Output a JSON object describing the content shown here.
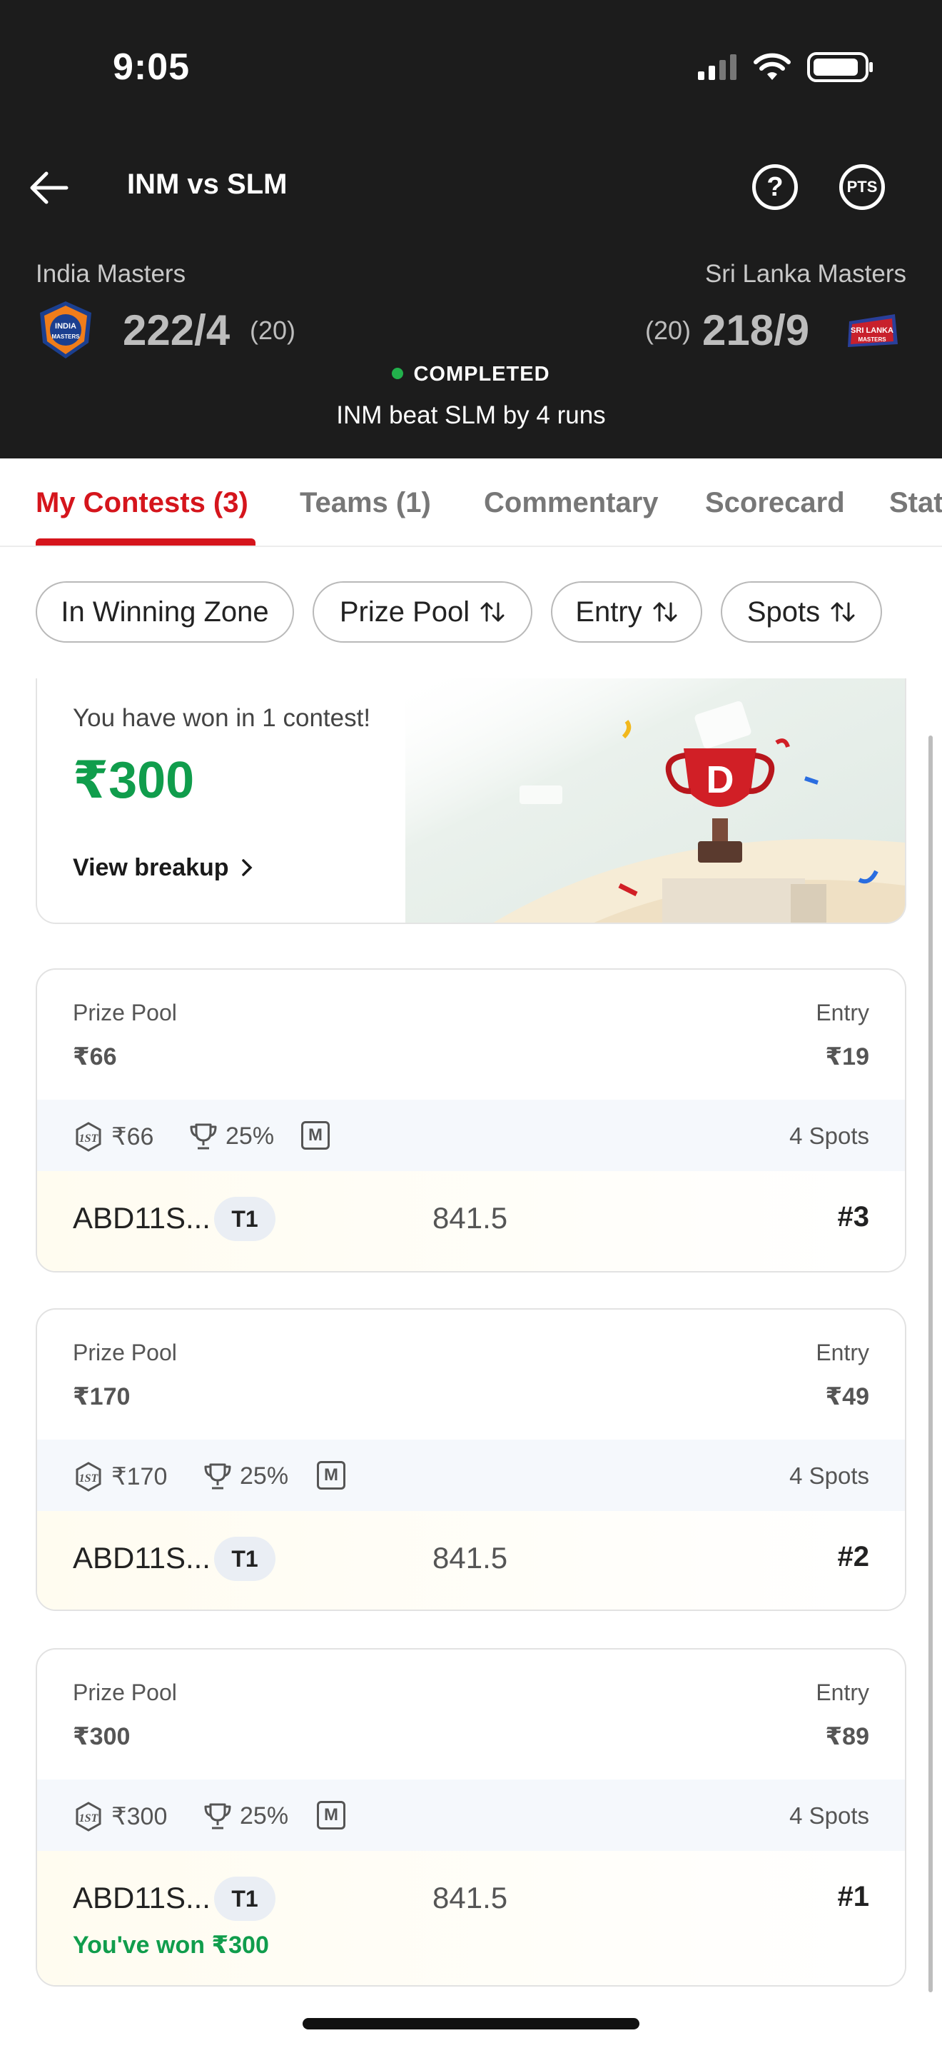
{
  "status_bar": {
    "time": "9:05"
  },
  "nav": {
    "title": "INM vs SLM",
    "help": "?",
    "pts": "PTS"
  },
  "match": {
    "team_left": {
      "name": "India Masters",
      "logo_text": "INDIA MASTERS",
      "score": "222/4",
      "overs": "(20)"
    },
    "team_right": {
      "name": "Sri Lanka Masters",
      "logo_text": "SRI LANKA MASTERS",
      "score": "218/9",
      "overs": "(20)"
    },
    "status": "COMPLETED",
    "result": "INM beat SLM by 4 runs"
  },
  "tabs": [
    {
      "label": "My Contests (3)",
      "active": true
    },
    {
      "label": "Teams (1)"
    },
    {
      "label": "Commentary"
    },
    {
      "label": "Scorecard"
    },
    {
      "label": "Stat"
    }
  ],
  "filters": [
    {
      "label": "In Winning Zone",
      "sort": false
    },
    {
      "label": "Prize Pool",
      "sort": true
    },
    {
      "label": "Entry",
      "sort": true
    },
    {
      "label": "Spots",
      "sort": true
    }
  ],
  "winnings": {
    "text": "You have won in 1 contest!",
    "amount": "₹300",
    "breakup_label": "View breakup",
    "trophy_letter": "D"
  },
  "contests": [
    {
      "prize_pool_label": "Prize Pool",
      "prize_pool": "₹66",
      "entry_label": "Entry",
      "entry": "₹19",
      "first_prize": "₹66",
      "winners": "25%",
      "m_badge": "M",
      "spots": "4 Spots",
      "team": "ABD11S...",
      "team_badge": "T1",
      "points": "841.5",
      "rank": "#3",
      "won": ""
    },
    {
      "prize_pool_label": "Prize Pool",
      "prize_pool": "₹170",
      "entry_label": "Entry",
      "entry": "₹49",
      "first_prize": "₹170",
      "winners": "25%",
      "m_badge": "M",
      "spots": "4 Spots",
      "team": "ABD11S...",
      "team_badge": "T1",
      "points": "841.5",
      "rank": "#2",
      "won": ""
    },
    {
      "prize_pool_label": "Prize Pool",
      "prize_pool": "₹300",
      "entry_label": "Entry",
      "entry": "₹89",
      "first_prize": "₹300",
      "winners": "25%",
      "m_badge": "M",
      "spots": "4 Spots",
      "team": "ABD11S...",
      "team_badge": "T1",
      "points": "841.5",
      "rank": "#1",
      "won": "You've won ₹300"
    }
  ],
  "colors": {
    "accent": "#d5151c",
    "win_green": "#109d4c",
    "header_bg": "#1c1c1c"
  }
}
